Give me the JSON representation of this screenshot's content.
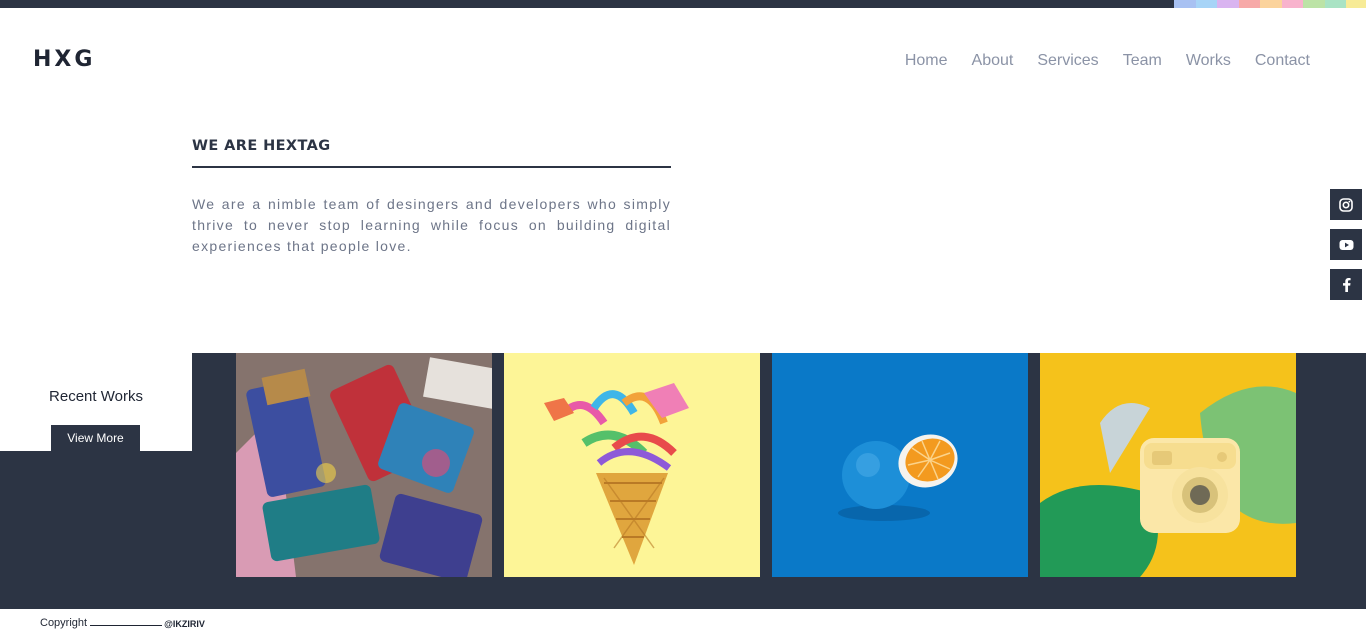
{
  "brand": {
    "logo": "HXG"
  },
  "top_swatch_colors": [
    "#a8c1f2",
    "#a7d4f7",
    "#d9b4f0",
    "#f7a9a8",
    "#fbd39c",
    "#f8b3cd",
    "#bce3a6",
    "#a9e3c4",
    "#f7eb97",
    "#d6d6dd"
  ],
  "nav": {
    "items": [
      "Home",
      "About",
      "Services",
      "Team",
      "Works",
      "Contact"
    ]
  },
  "hero": {
    "title": "WE ARE HEXTAG",
    "text": "We are a nimble team of desingers and developers who simply thrive to never stop learning while focus on building digital experiences that people love."
  },
  "social": {
    "icons": [
      "instagram-icon",
      "youtube-icon",
      "facebook-icon"
    ]
  },
  "works": {
    "label": "Recent Works",
    "button": "View More",
    "tiles": [
      "paint-brushes",
      "confetti-ice-cream-cone",
      "blue-orange",
      "instant-camera"
    ]
  },
  "footer": {
    "copyright": "Copyright",
    "handle": "@IKZIRIV"
  },
  "colors": {
    "dark": "#2c3444",
    "nav_text": "#8b93a6",
    "body_text": "#6d7588"
  }
}
